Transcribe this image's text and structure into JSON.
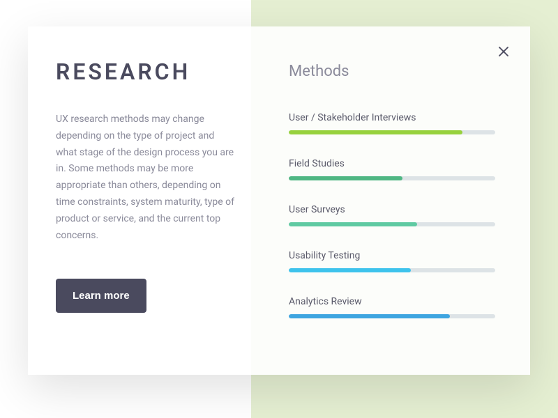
{
  "card": {
    "title": "RESEARCH",
    "description": "UX research methods may change depending on the type of project and what stage of the design process you are in. Some methods may be more appropriate than others, depending on time constraints, system maturity, type of product or service, and the current top concerns.",
    "button_label": "Learn more"
  },
  "methods": {
    "heading": "Methods",
    "items": [
      {
        "label": "User / Stakeholder Interviews",
        "percent": 84,
        "color": "#97d13d"
      },
      {
        "label": "Field Studies",
        "percent": 55,
        "color": "#4fb783"
      },
      {
        "label": "User Surveys",
        "percent": 62,
        "color": "#5fcaa2"
      },
      {
        "label": "Usability Testing",
        "percent": 59,
        "color": "#3ec3ec"
      },
      {
        "label": "Analytics Review",
        "percent": 78,
        "color": "#3ea5e0"
      }
    ]
  },
  "chart_data": {
    "type": "bar",
    "title": "Methods",
    "categories": [
      "User / Stakeholder Interviews",
      "Field Studies",
      "User Surveys",
      "Usability Testing",
      "Analytics Review"
    ],
    "values": [
      84,
      55,
      62,
      59,
      78
    ],
    "ylim": [
      0,
      100
    ]
  }
}
